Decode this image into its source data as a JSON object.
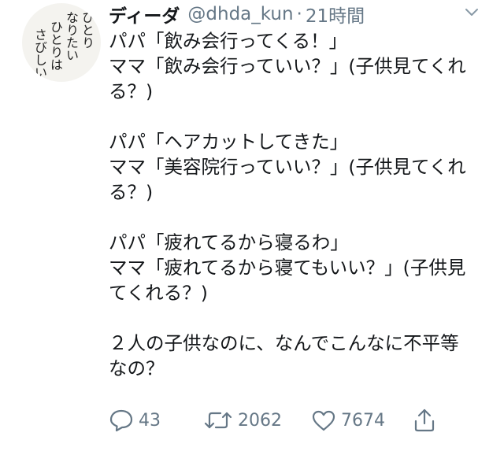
{
  "avatar": {
    "columns": [
      "ひとり",
      "なりたい",
      "ひとりは",
      "さびしい"
    ]
  },
  "header": {
    "display_name": "ディーダ",
    "handle": "@dhda_kun",
    "separator": "·",
    "time": "21時間"
  },
  "tweet": {
    "lines": [
      "パパ「飲み会行ってくる！」",
      "ママ「飲み会行っていい？」(子供見てくれ",
      "る？)",
      "",
      "パパ「ヘアカットしてきた」",
      "ママ「美容院行っていい？」(子供見てくれ",
      "る？)",
      "",
      "パパ「疲れてるから寝るわ」",
      "ママ「疲れてるから寝てもいい？」(子供見",
      "てくれる？)",
      "",
      "２人の子供なのに、なんでこんなに不平等",
      "なの？"
    ]
  },
  "actions": {
    "reply_count": "43",
    "retweet_count": "2062",
    "like_count": "7674",
    "icons": [
      "reply-icon",
      "retweet-icon",
      "heart-icon",
      "share-icon"
    ]
  },
  "colors": {
    "text": "#14171a",
    "secondary": "#657786",
    "avatar_bg": "#f4f3ef"
  }
}
